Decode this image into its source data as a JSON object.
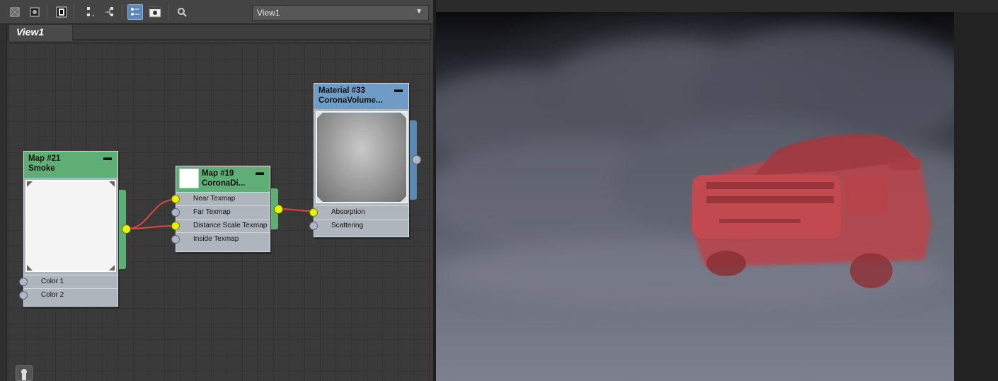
{
  "toolbar": {
    "view_dropdown": "View1",
    "icons": [
      "select-icon",
      "pick-icon",
      "material-slot-icon",
      "layout-icon",
      "hierarchy-icon",
      "show-shaded-icon",
      "background-icon",
      "find-icon"
    ]
  },
  "tabs": [
    {
      "label": "View1"
    }
  ],
  "nodes": {
    "smoke": {
      "title": "Map #21",
      "subtitle": "Smoke",
      "slots": [
        "Color 1",
        "Color 2"
      ]
    },
    "corona_dist": {
      "title": "Map #19",
      "subtitle": "CoronaDi...",
      "slots": [
        "Near Texmap",
        "Far Texmap",
        "Distance Scale Texmap",
        "Inside Texmap"
      ]
    },
    "material": {
      "title": "Material #33",
      "subtitle": "CoronaVolume...",
      "slots": [
        "Absorption",
        "Scattering"
      ]
    }
  },
  "colors": {
    "map_header": "#5fae76",
    "material_header": "#6f9cc4",
    "wire": "#e2453b",
    "active_port": "#e5f200",
    "truck": "#c9474c"
  }
}
